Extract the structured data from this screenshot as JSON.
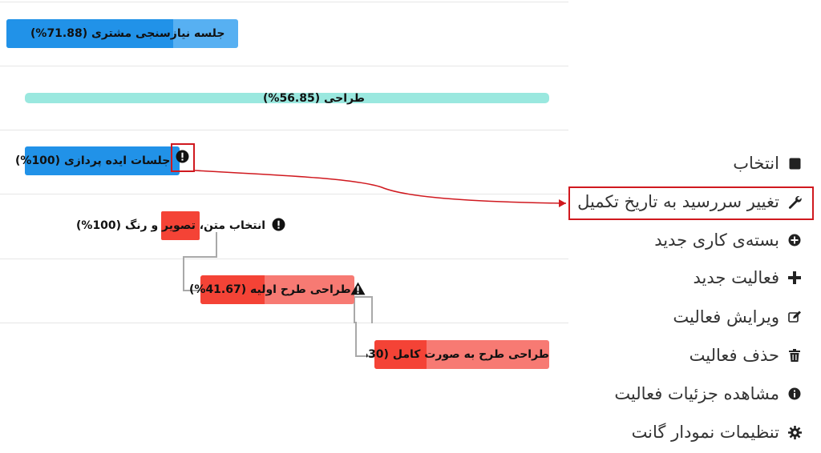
{
  "gantt": {
    "tasks": [
      {
        "label": "جلسه نیازسنجی مشتری (71.88%)",
        "progress": 71.88,
        "color": "#57b0f2",
        "fill_color": "#2192e8"
      },
      {
        "label": "طراحی (56.85%)",
        "progress": 56.85,
        "color": "#9ae8df",
        "fill_color": "#9ae8df"
      },
      {
        "label": "جلسات ایده پردازی (100%)",
        "progress": 100,
        "color": "#2192e8",
        "fill_color": "#2192e8",
        "icon": "exclamation-circle-icon"
      },
      {
        "label": "انتخاب متن، تصویر و رنگ (100%)",
        "progress": 100,
        "color": "#f44336",
        "fill_color": "#f44336",
        "icon": "exclamation-circle-icon"
      },
      {
        "label": "طراحی طرح اولیه (41.67%)",
        "progress": 41.67,
        "color": "#f77a73",
        "fill_color": "#f44336",
        "icon": "warning-triangle-icon"
      },
      {
        "label": "طراحی طرح به صورت کامل (30%)",
        "progress": 30,
        "color": "#f77a73",
        "fill_color": "#f44336"
      }
    ]
  },
  "context_menu": {
    "items": [
      {
        "label": "انتخاب",
        "icon": "square-icon"
      },
      {
        "label": "تغییر سررسید به تاریخ تکمیل",
        "icon": "wrench-icon",
        "highlighted": true
      },
      {
        "label": "بسته‌ی کاری جدید",
        "icon": "plus-circle-icon"
      },
      {
        "label": "فعالیت جدید",
        "icon": "plus-icon"
      },
      {
        "label": "ویرایش فعالیت",
        "icon": "edit-icon"
      },
      {
        "label": "حذف فعالیت",
        "icon": "trash-icon"
      },
      {
        "label": "مشاهده جزئیات فعالیت",
        "icon": "info-circle-icon"
      },
      {
        "label": "تنظیمات نمودار گانت",
        "icon": "gear-icon"
      }
    ]
  },
  "colors": {
    "highlight_border": "#d0191f",
    "connector": "#a9a9a9"
  }
}
